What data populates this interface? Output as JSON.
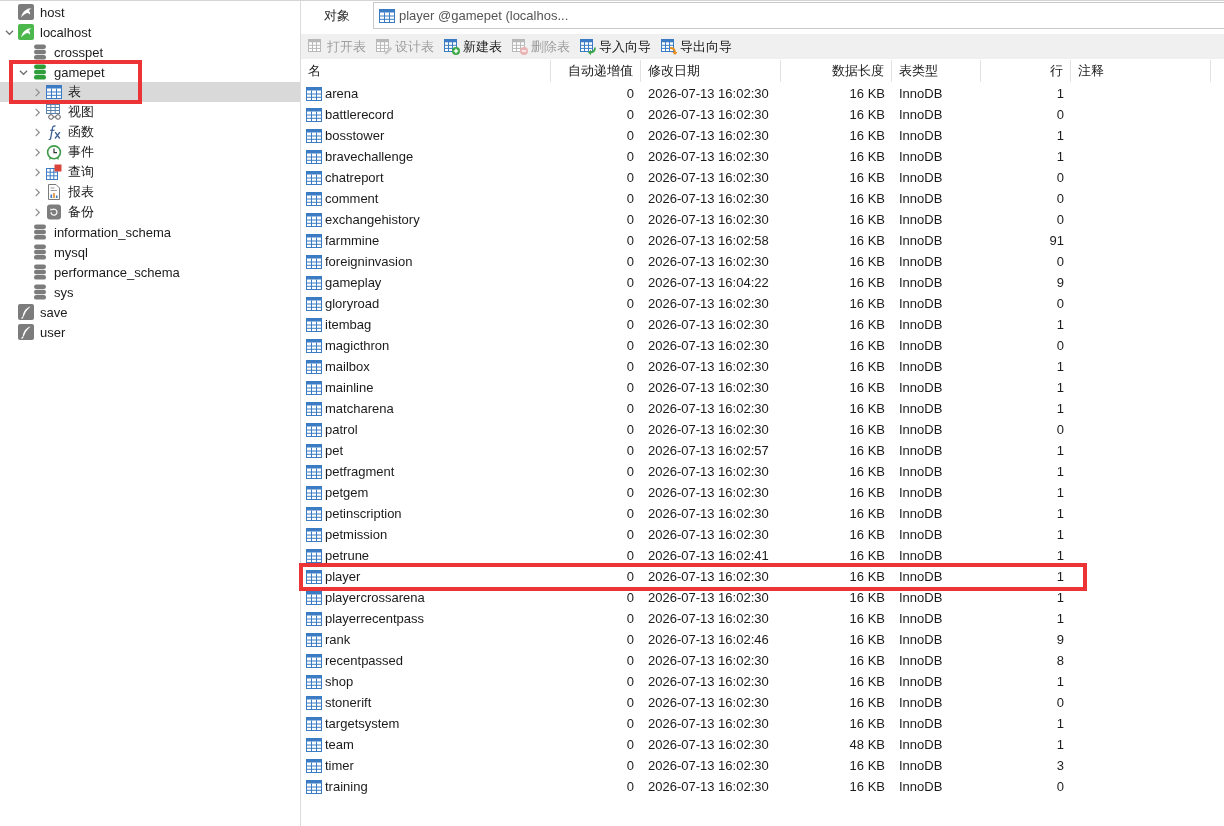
{
  "tree": [
    {
      "label": "host",
      "kind": "mysql",
      "open": false,
      "selected": false
    },
    {
      "label": "localhost",
      "kind": "mysql",
      "open": true,
      "expanded": true,
      "selected": false,
      "children": [
        {
          "label": "crosspet",
          "kind": "database",
          "open": false,
          "selected": false
        },
        {
          "label": "gamepet",
          "kind": "database",
          "open": true,
          "expanded": true,
          "selected": false,
          "outlined": true,
          "children": [
            {
              "label": "表",
              "kind": "tables",
              "expanded": false,
              "selected": true,
              "outlined": true
            },
            {
              "label": "视图",
              "kind": "views",
              "expanded": false,
              "selected": false
            },
            {
              "label": "函数",
              "kind": "functions",
              "expanded": false,
              "selected": false
            },
            {
              "label": "事件",
              "kind": "events",
              "expanded": false,
              "selected": false
            },
            {
              "label": "查询",
              "kind": "queries",
              "expanded": false,
              "selected": false
            },
            {
              "label": "报表",
              "kind": "reports",
              "expanded": false,
              "selected": false
            },
            {
              "label": "备份",
              "kind": "backups",
              "expanded": false,
              "selected": false
            }
          ]
        },
        {
          "label": "information_schema",
          "kind": "database",
          "open": false,
          "selected": false
        },
        {
          "label": "mysql",
          "kind": "database",
          "open": false,
          "selected": false
        },
        {
          "label": "performance_schema",
          "kind": "database",
          "open": false,
          "selected": false
        },
        {
          "label": "sys",
          "kind": "database",
          "open": false,
          "selected": false
        }
      ]
    },
    {
      "label": "save",
      "kind": "sqlite",
      "open": false,
      "selected": false
    },
    {
      "label": "user",
      "kind": "sqlite",
      "open": false,
      "selected": false
    }
  ],
  "tabs": [
    {
      "label": "对象",
      "kind": "objects",
      "selected": true
    },
    {
      "label": "player @gamepet (localhos...",
      "kind": "table",
      "selected": false
    }
  ],
  "toolbar": [
    {
      "label": "打开表",
      "kind": "open",
      "disabled": true
    },
    {
      "label": "设计表",
      "kind": "design",
      "disabled": true
    },
    {
      "label": "新建表",
      "kind": "new",
      "disabled": false
    },
    {
      "label": "删除表",
      "kind": "delete",
      "disabled": true
    },
    {
      "label": "导入向导",
      "kind": "import",
      "disabled": false
    },
    {
      "label": "导出向导",
      "kind": "export",
      "disabled": false
    }
  ],
  "table": {
    "columns": [
      "名",
      "自动递增值",
      "修改日期",
      "数据长度",
      "表类型",
      "行",
      "注释"
    ],
    "rows": [
      {
        "name": "arena",
        "auto_increment": "0",
        "modified": "2026-07-13 16:02:30",
        "data_length": "16 KB",
        "engine": "InnoDB",
        "rows": "1"
      },
      {
        "name": "battlerecord",
        "auto_increment": "0",
        "modified": "2026-07-13 16:02:30",
        "data_length": "16 KB",
        "engine": "InnoDB",
        "rows": "0"
      },
      {
        "name": "bosstower",
        "auto_increment": "0",
        "modified": "2026-07-13 16:02:30",
        "data_length": "16 KB",
        "engine": "InnoDB",
        "rows": "1"
      },
      {
        "name": "bravechallenge",
        "auto_increment": "0",
        "modified": "2026-07-13 16:02:30",
        "data_length": "16 KB",
        "engine": "InnoDB",
        "rows": "1"
      },
      {
        "name": "chatreport",
        "auto_increment": "0",
        "modified": "2026-07-13 16:02:30",
        "data_length": "16 KB",
        "engine": "InnoDB",
        "rows": "0"
      },
      {
        "name": "comment",
        "auto_increment": "0",
        "modified": "2026-07-13 16:02:30",
        "data_length": "16 KB",
        "engine": "InnoDB",
        "rows": "0"
      },
      {
        "name": "exchangehistory",
        "auto_increment": "0",
        "modified": "2026-07-13 16:02:30",
        "data_length": "16 KB",
        "engine": "InnoDB",
        "rows": "0"
      },
      {
        "name": "farmmine",
        "auto_increment": "0",
        "modified": "2026-07-13 16:02:58",
        "data_length": "16 KB",
        "engine": "InnoDB",
        "rows": "91"
      },
      {
        "name": "foreigninvasion",
        "auto_increment": "0",
        "modified": "2026-07-13 16:02:30",
        "data_length": "16 KB",
        "engine": "InnoDB",
        "rows": "0"
      },
      {
        "name": "gameplay",
        "auto_increment": "0",
        "modified": "2026-07-13 16:04:22",
        "data_length": "16 KB",
        "engine": "InnoDB",
        "rows": "9"
      },
      {
        "name": "gloryroad",
        "auto_increment": "0",
        "modified": "2026-07-13 16:02:30",
        "data_length": "16 KB",
        "engine": "InnoDB",
        "rows": "0"
      },
      {
        "name": "itembag",
        "auto_increment": "0",
        "modified": "2026-07-13 16:02:30",
        "data_length": "16 KB",
        "engine": "InnoDB",
        "rows": "1"
      },
      {
        "name": "magicthron",
        "auto_increment": "0",
        "modified": "2026-07-13 16:02:30",
        "data_length": "16 KB",
        "engine": "InnoDB",
        "rows": "0"
      },
      {
        "name": "mailbox",
        "auto_increment": "0",
        "modified": "2026-07-13 16:02:30",
        "data_length": "16 KB",
        "engine": "InnoDB",
        "rows": "1"
      },
      {
        "name": "mainline",
        "auto_increment": "0",
        "modified": "2026-07-13 16:02:30",
        "data_length": "16 KB",
        "engine": "InnoDB",
        "rows": "1"
      },
      {
        "name": "matcharena",
        "auto_increment": "0",
        "modified": "2026-07-13 16:02:30",
        "data_length": "16 KB",
        "engine": "InnoDB",
        "rows": "1"
      },
      {
        "name": "patrol",
        "auto_increment": "0",
        "modified": "2026-07-13 16:02:30",
        "data_length": "16 KB",
        "engine": "InnoDB",
        "rows": "0"
      },
      {
        "name": "pet",
        "auto_increment": "0",
        "modified": "2026-07-13 16:02:57",
        "data_length": "16 KB",
        "engine": "InnoDB",
        "rows": "1"
      },
      {
        "name": "petfragment",
        "auto_increment": "0",
        "modified": "2026-07-13 16:02:30",
        "data_length": "16 KB",
        "engine": "InnoDB",
        "rows": "1"
      },
      {
        "name": "petgem",
        "auto_increment": "0",
        "modified": "2026-07-13 16:02:30",
        "data_length": "16 KB",
        "engine": "InnoDB",
        "rows": "1"
      },
      {
        "name": "petinscription",
        "auto_increment": "0",
        "modified": "2026-07-13 16:02:30",
        "data_length": "16 KB",
        "engine": "InnoDB",
        "rows": "1"
      },
      {
        "name": "petmission",
        "auto_increment": "0",
        "modified": "2026-07-13 16:02:30",
        "data_length": "16 KB",
        "engine": "InnoDB",
        "rows": "1"
      },
      {
        "name": "petrune",
        "auto_increment": "0",
        "modified": "2026-07-13 16:02:41",
        "data_length": "16 KB",
        "engine": "InnoDB",
        "rows": "1"
      },
      {
        "name": "player",
        "auto_increment": "0",
        "modified": "2026-07-13 16:02:30",
        "data_length": "16 KB",
        "engine": "InnoDB",
        "rows": "1",
        "outlined": true
      },
      {
        "name": "playercrossarena",
        "auto_increment": "0",
        "modified": "2026-07-13 16:02:30",
        "data_length": "16 KB",
        "engine": "InnoDB",
        "rows": "1"
      },
      {
        "name": "playerrecentpass",
        "auto_increment": "0",
        "modified": "2026-07-13 16:02:30",
        "data_length": "16 KB",
        "engine": "InnoDB",
        "rows": "1"
      },
      {
        "name": "rank",
        "auto_increment": "0",
        "modified": "2026-07-13 16:02:46",
        "data_length": "16 KB",
        "engine": "InnoDB",
        "rows": "9"
      },
      {
        "name": "recentpassed",
        "auto_increment": "0",
        "modified": "2026-07-13 16:02:30",
        "data_length": "16 KB",
        "engine": "InnoDB",
        "rows": "8"
      },
      {
        "name": "shop",
        "auto_increment": "0",
        "modified": "2026-07-13 16:02:30",
        "data_length": "16 KB",
        "engine": "InnoDB",
        "rows": "1"
      },
      {
        "name": "stonerift",
        "auto_increment": "0",
        "modified": "2026-07-13 16:02:30",
        "data_length": "16 KB",
        "engine": "InnoDB",
        "rows": "0"
      },
      {
        "name": "targetsystem",
        "auto_increment": "0",
        "modified": "2026-07-13 16:02:30",
        "data_length": "16 KB",
        "engine": "InnoDB",
        "rows": "1"
      },
      {
        "name": "team",
        "auto_increment": "0",
        "modified": "2026-07-13 16:02:30",
        "data_length": "48 KB",
        "engine": "InnoDB",
        "rows": "1"
      },
      {
        "name": "timer",
        "auto_increment": "0",
        "modified": "2026-07-13 16:02:30",
        "data_length": "16 KB",
        "engine": "InnoDB",
        "rows": "3"
      },
      {
        "name": "training",
        "auto_increment": "0",
        "modified": "2026-07-13 16:02:30",
        "data_length": "16 KB",
        "engine": "InnoDB",
        "rows": "0"
      }
    ]
  }
}
